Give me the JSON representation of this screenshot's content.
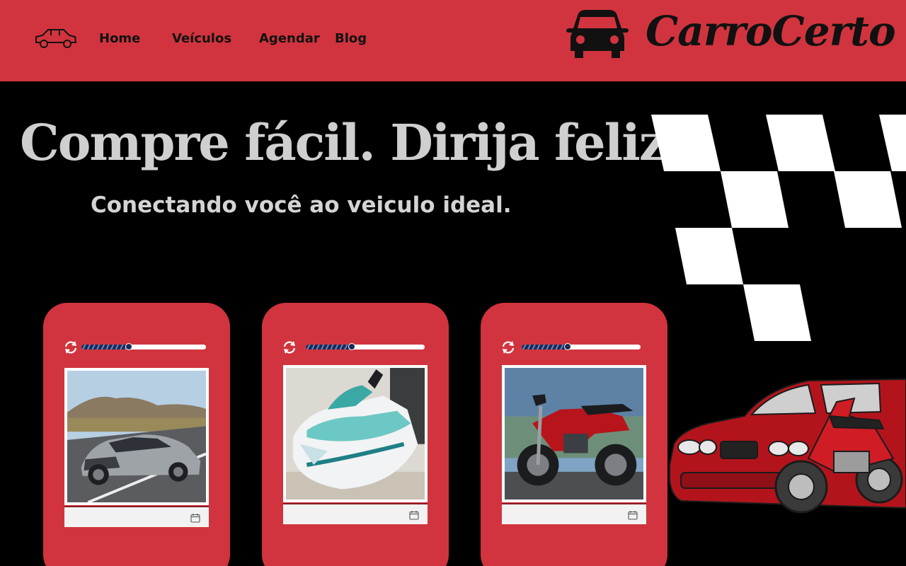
{
  "header": {
    "nav": [
      {
        "label": "Home"
      },
      {
        "label": "Veículos"
      },
      {
        "label": "Agendar"
      },
      {
        "label": "Blog"
      }
    ],
    "brand": "CarroCerto"
  },
  "hero": {
    "title": "Compre fácil. Dirija feliz.",
    "subtitle": "Conectando você ao veiculo ideal."
  },
  "cards": [
    {
      "image": "silver-supercar-photo",
      "progress": 0.37
    },
    {
      "image": "jet-ski-photo",
      "progress": 0.38
    },
    {
      "image": "red-motorcycle-photo",
      "progress": 0.38
    }
  ],
  "colors": {
    "accent": "#d1343e",
    "background": "#000000",
    "hero_text": "#cfcfcf",
    "progress": "#1b2a55"
  }
}
